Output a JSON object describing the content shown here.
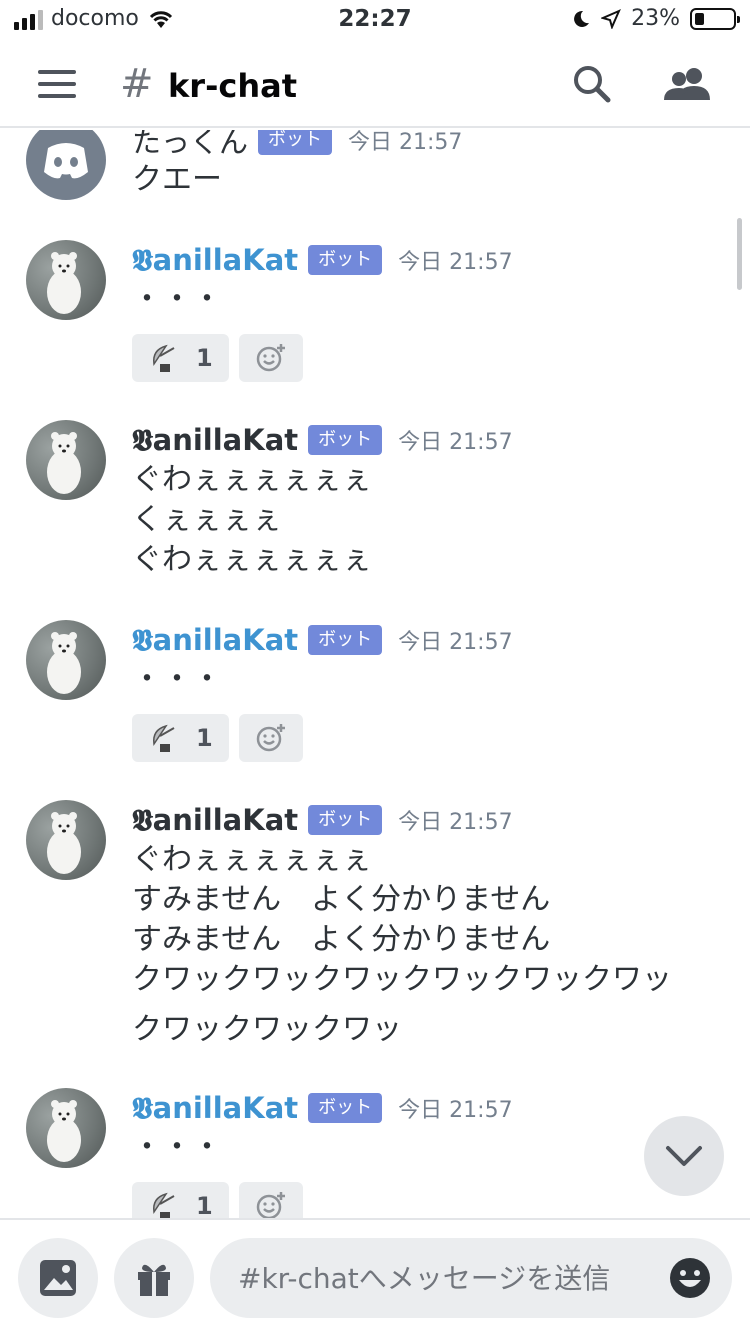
{
  "status_bar": {
    "carrier": "docomo",
    "time": "22:27",
    "battery": "23%"
  },
  "header": {
    "hash": "#",
    "channel": "kr-chat"
  },
  "messages": [
    {
      "author": "たっくん",
      "bot_tag": "ボット",
      "timestamp": "今日 21:57",
      "lines": [
        "クエー"
      ],
      "avatar": "discord-logo-icon"
    },
    {
      "author": "𝖁anillaKat",
      "bot_tag": "ボット",
      "timestamp": "今日 21:57",
      "lines": [
        "・・・"
      ],
      "reaction": {
        "icon": "satellite-antenna-icon",
        "count": "1"
      }
    },
    {
      "author": "𝖁anillaKat",
      "bot_tag": "ボット",
      "timestamp": "今日 21:57",
      "lines": [
        "ぐわぇぇぇぇぇぇ",
        "くぇぇぇぇ",
        "ぐわぇぇぇぇぇぇ"
      ]
    },
    {
      "author": "𝖁anillaKat",
      "bot_tag": "ボット",
      "timestamp": "今日 21:57",
      "lines": [
        "・・・"
      ],
      "reaction": {
        "icon": "satellite-antenna-icon",
        "count": "1"
      }
    },
    {
      "author": "𝖁anillaKat",
      "bot_tag": "ボット",
      "timestamp": "今日 21:57",
      "lines": [
        "ぐわぇぇぇぇぇぇ",
        "すみません　よく分かりません",
        "すみません　よく分かりません",
        "クワックワックワックワックワックワッ",
        "クワックワックワッ"
      ]
    },
    {
      "author": "𝖁anillaKat",
      "bot_tag": "ボット",
      "timestamp": "今日 21:57",
      "lines": [
        "・・・"
      ],
      "reaction": {
        "icon": "satellite-antenna-icon",
        "count": "1"
      }
    }
  ],
  "composer": {
    "placeholder": "#kr-chatへメッセージを送信"
  },
  "colors": {
    "bot_tag": "#7289da",
    "username_blue": "#3e93d1",
    "text": "#2e3338",
    "muted": "#747f8d"
  }
}
